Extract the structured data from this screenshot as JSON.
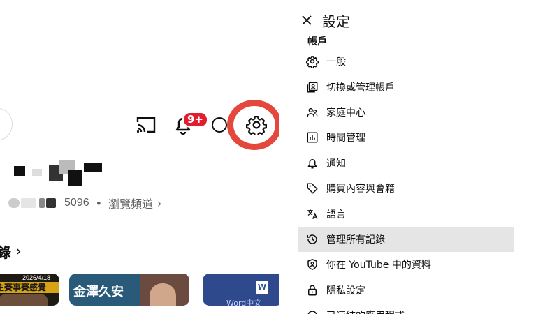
{
  "header_icons": {
    "notification_badge": "9+"
  },
  "channel": {
    "count": "5096",
    "separator": "•",
    "browse_label": "瀏覽頻道",
    "browse_chevron": "›"
  },
  "section": {
    "title": "錄",
    "chevron": "›"
  },
  "thumbnails": [
    {
      "date": "2026/4/18",
      "title": "主賽事賽感覺"
    },
    {
      "title": "金澤久安"
    },
    {
      "logo": "W",
      "title": "Word中文"
    }
  ],
  "settings": {
    "title": "設定",
    "section_label": "帳戶",
    "items": [
      {
        "icon": "gear-icon",
        "label": "一般"
      },
      {
        "icon": "switch-account-icon",
        "label": "切換或管理帳戶"
      },
      {
        "icon": "family-icon",
        "label": "家庭中心"
      },
      {
        "icon": "bar-chart-icon",
        "label": "時間管理"
      },
      {
        "icon": "bell-icon",
        "label": "通知"
      },
      {
        "icon": "tag-icon",
        "label": "購買內容與會籍"
      },
      {
        "icon": "translate-icon",
        "label": "語言"
      },
      {
        "icon": "history-icon",
        "label": "管理所有記錄",
        "active": true
      },
      {
        "icon": "shield-person-icon",
        "label": "你在 YouTube 中的資料"
      },
      {
        "icon": "lock-icon",
        "label": "隱私設定"
      },
      {
        "icon": "connected-apps-icon",
        "label": "已連結的應用程式"
      }
    ]
  },
  "colors": {
    "highlight_ring": "#e4473c",
    "badge": "#e11d2e",
    "active_row": "#e5e5e5"
  }
}
